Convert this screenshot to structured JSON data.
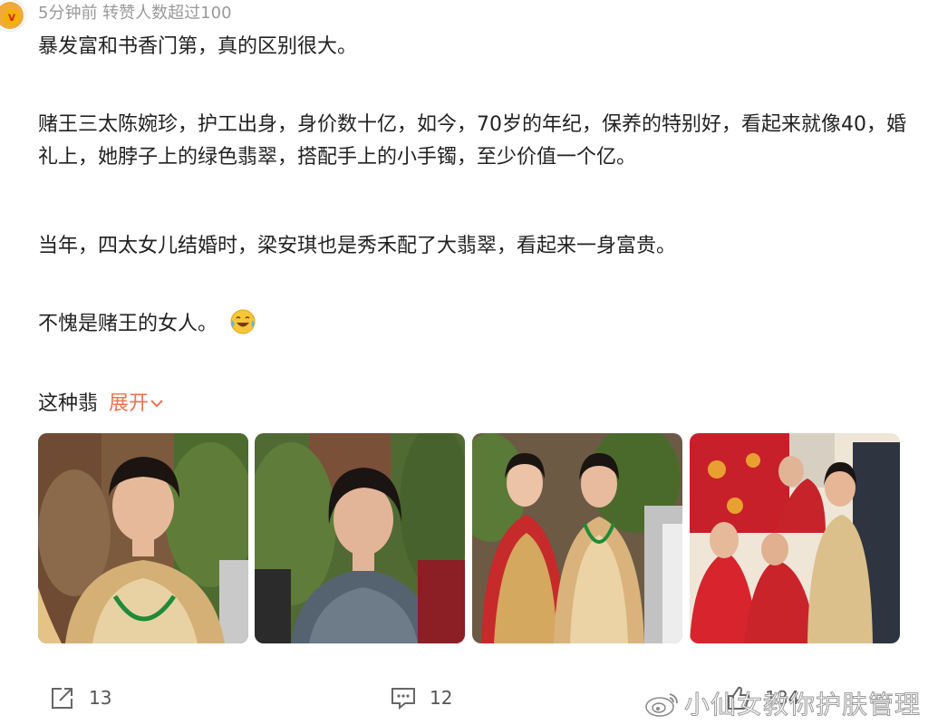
{
  "post": {
    "meta": "5分钟前 转赞人数超过100",
    "paragraphs": [
      "暴发富和书香门第，真的区别很大。",
      "赌王三太陈婉珍，护工出身，身价数十亿，如今，70岁的年纪，保养的特别好，看起来就像40，婚礼上，她脖子上的绿色翡翠，搭配手上的小手镯，至少价值一个亿。",
      "当年，四太女儿结婚时，梁安琪也是秀禾配了大翡翠，看起来一身富贵。",
      "不愧是赌王的女人。"
    ],
    "emoji": "laugh-cry-emoji",
    "collapsed_text": "这种翡",
    "expand_label": "展开"
  },
  "photos": [
    {
      "name": "photo-1"
    },
    {
      "name": "photo-2"
    },
    {
      "name": "photo-3"
    },
    {
      "name": "photo-4"
    }
  ],
  "actions": {
    "share_count": "13",
    "comment_count": "12",
    "like_count": "184"
  },
  "watermark": {
    "text": "小仙女教你护肤管理"
  },
  "colors": {
    "accent": "#eb7350",
    "meta": "#999999",
    "text": "#222222"
  }
}
